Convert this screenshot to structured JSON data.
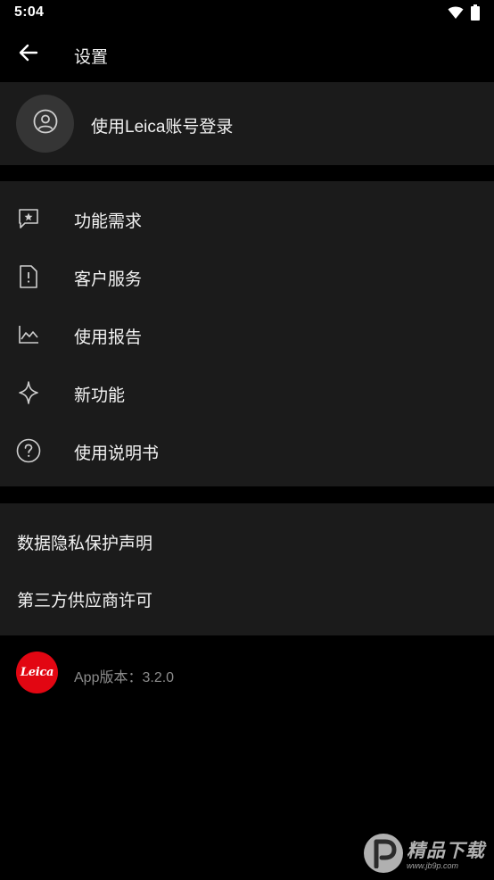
{
  "status_bar": {
    "time": "5:04",
    "icons": [
      "wifi-icon",
      "battery-icon"
    ]
  },
  "toolbar": {
    "back_icon": "arrow-left-icon",
    "title": "设置"
  },
  "account": {
    "icon": "user-circle-icon",
    "label": "使用Leica账号登录"
  },
  "menu": {
    "items": [
      {
        "icon": "feedback-star-icon",
        "label": "功能需求"
      },
      {
        "icon": "service-alert-icon",
        "label": "客户服务"
      },
      {
        "icon": "chart-line-icon",
        "label": "使用报告"
      },
      {
        "icon": "sparkle-icon",
        "label": "新功能"
      },
      {
        "icon": "help-circle-icon",
        "label": "使用说明书"
      }
    ]
  },
  "legal": {
    "items": [
      {
        "label": "数据隐私保护声明"
      },
      {
        "label": "第三方供应商许可"
      }
    ]
  },
  "footer": {
    "logo_text": "Leica",
    "version": "App版本：3.2.0"
  },
  "watermark": {
    "main": "精品下载",
    "sub": "www.jb9p.com"
  },
  "colors": {
    "background": "#000000",
    "card": "#1b1b1b",
    "text": "#f2f2f2",
    "secondary_text": "#8c8c8c",
    "leica_red": "#e20612"
  }
}
